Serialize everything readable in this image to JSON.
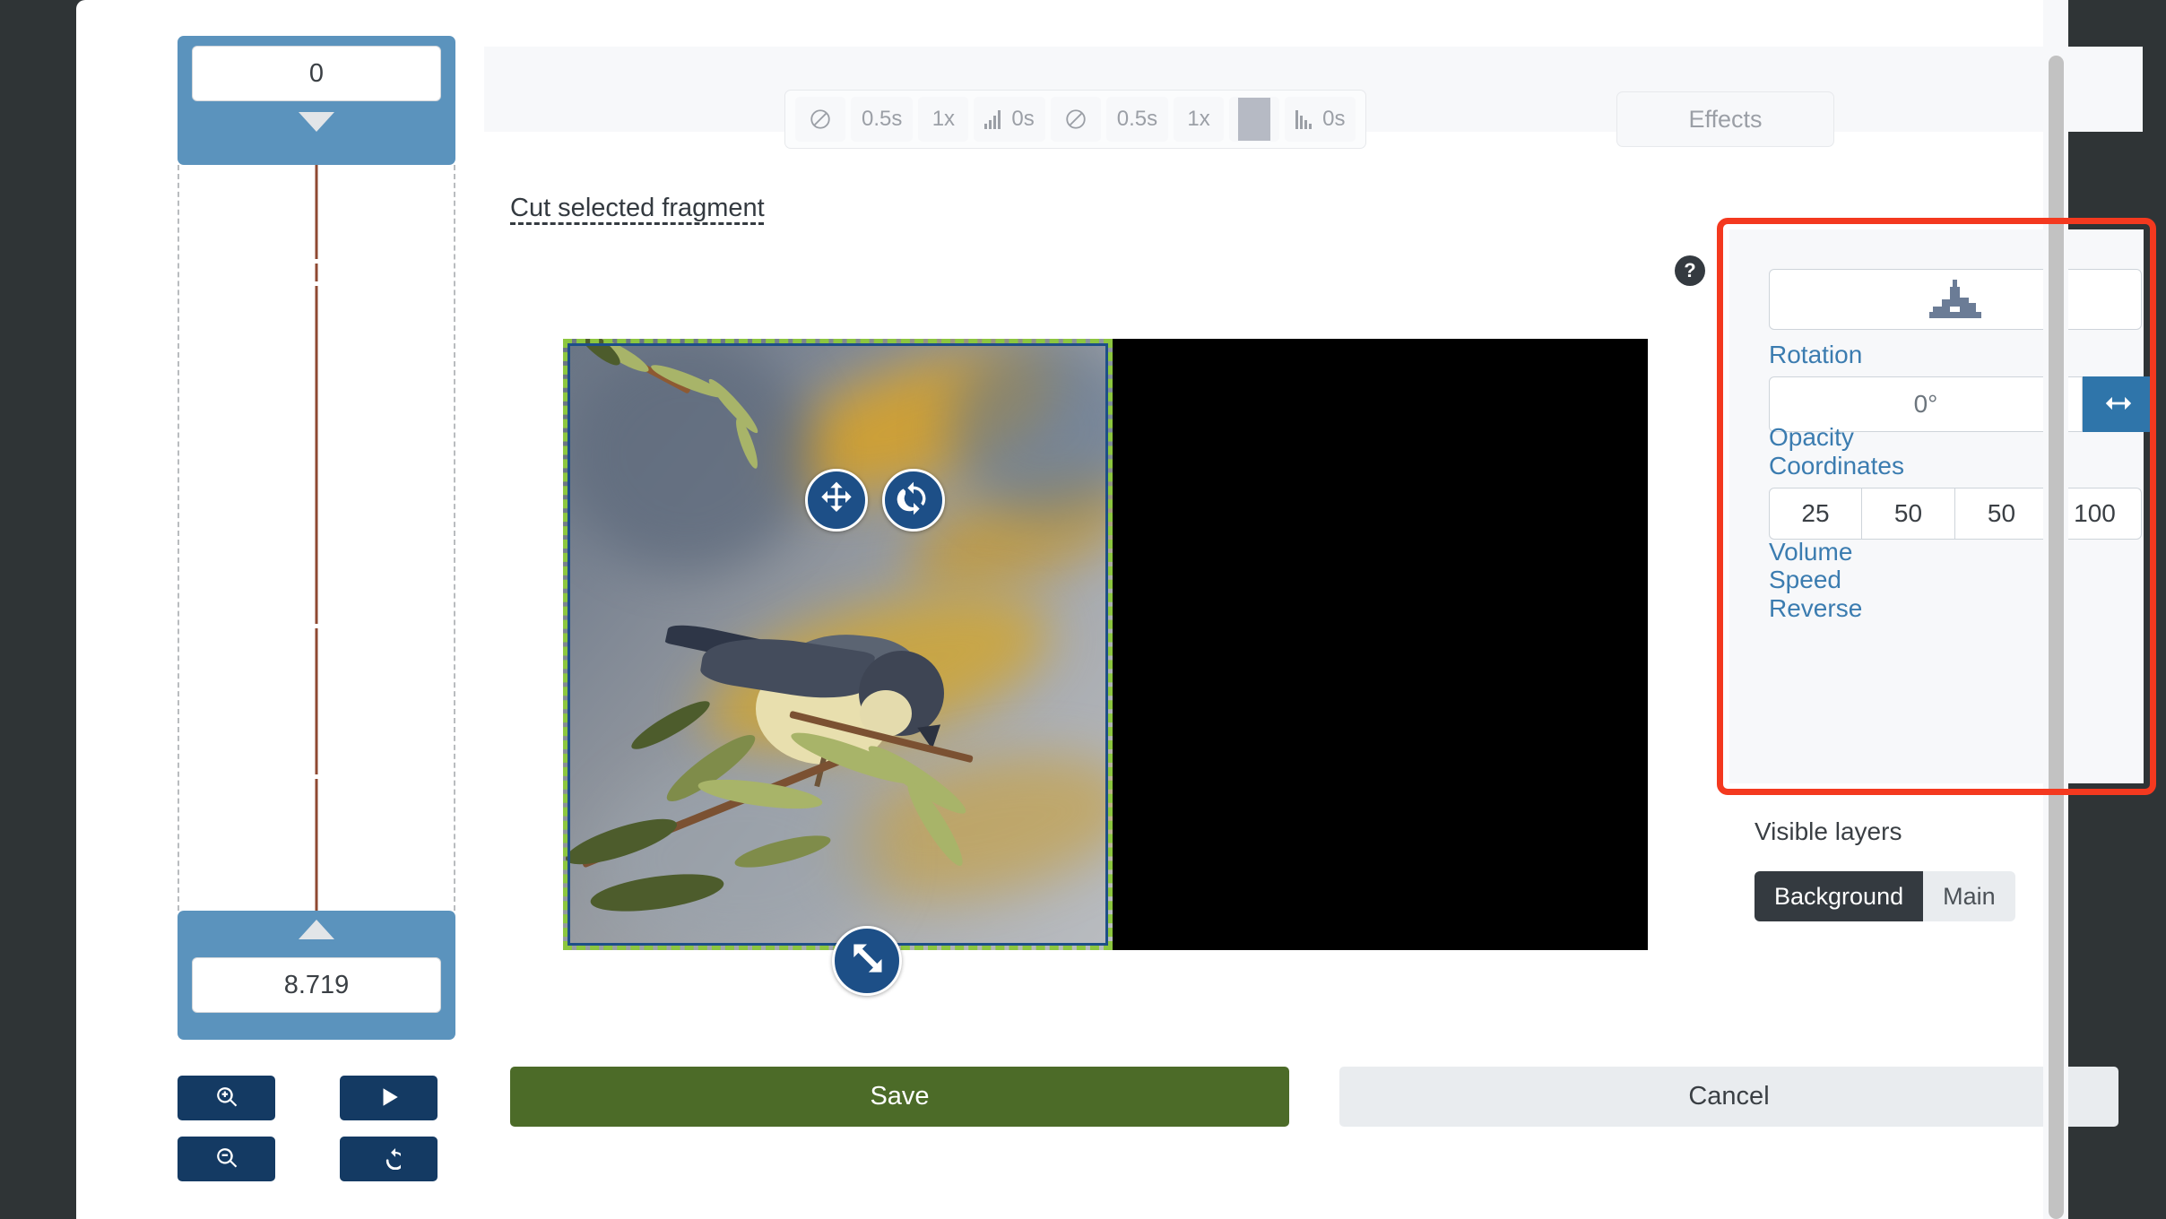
{
  "timeline": {
    "start_value": "0",
    "end_value": "8.719",
    "buttons": [
      {
        "name": "zoom-in-button",
        "icon": "zoom-in-icon"
      },
      {
        "name": "zoom-out-button",
        "icon": "zoom-out-icon"
      },
      {
        "name": "play-button",
        "icon": "play-icon"
      },
      {
        "name": "replay-button",
        "icon": "replay-icon"
      }
    ]
  },
  "toolbar": {
    "items": [
      {
        "label": "",
        "icon": "no-transition-icon"
      },
      {
        "label": "0.5s",
        "icon": ""
      },
      {
        "label": "1x",
        "icon": ""
      },
      {
        "label": "0s",
        "icon": "fade-in-icon"
      },
      {
        "label": "",
        "icon": "no-transition-icon"
      },
      {
        "label": "0.5s",
        "icon": ""
      },
      {
        "label": "1x",
        "icon": ""
      },
      {
        "label": "",
        "icon": "color-swatch-icon"
      },
      {
        "label": "0s",
        "icon": "fade-out-icon"
      }
    ],
    "effects_label": "Effects",
    "swatch_color": "#b6bac4"
  },
  "cut_fragment_label": "Cut selected fragment",
  "canvas": {
    "handles": [
      {
        "name": "move-handle",
        "icon": "move-arrows-icon"
      },
      {
        "name": "rotate-handle",
        "icon": "rotate-icon"
      },
      {
        "name": "resize-handle",
        "icon": "resize-diagonal-icon"
      }
    ],
    "selection_color": "#8cc63f",
    "selection_inner_color": "#1d4f87",
    "background_color": "#000000"
  },
  "properties": {
    "help_badge": "?",
    "thumbnail_icon": "cityscape-thumbnail-icon",
    "rotation_label": "Rotation",
    "rotation_value": "0°",
    "flip_icon": "flip-horizontal-icon",
    "opacity_label": "Opacity",
    "coordinates_label": "Coordinates",
    "coordinates": [
      "25",
      "50",
      "50",
      "100"
    ],
    "volume_label": "Volume",
    "speed_label": "Speed",
    "reverse_label": "Reverse",
    "highlight_color": "#f4391f",
    "link_color": "#3b7cb0"
  },
  "layers": {
    "title": "Visible layers",
    "options": [
      {
        "label": "Background",
        "active": true
      },
      {
        "label": "Main",
        "active": false
      }
    ]
  },
  "footer": {
    "save_label": "Save",
    "cancel_label": "Cancel",
    "save_color": "#4c6b28"
  }
}
